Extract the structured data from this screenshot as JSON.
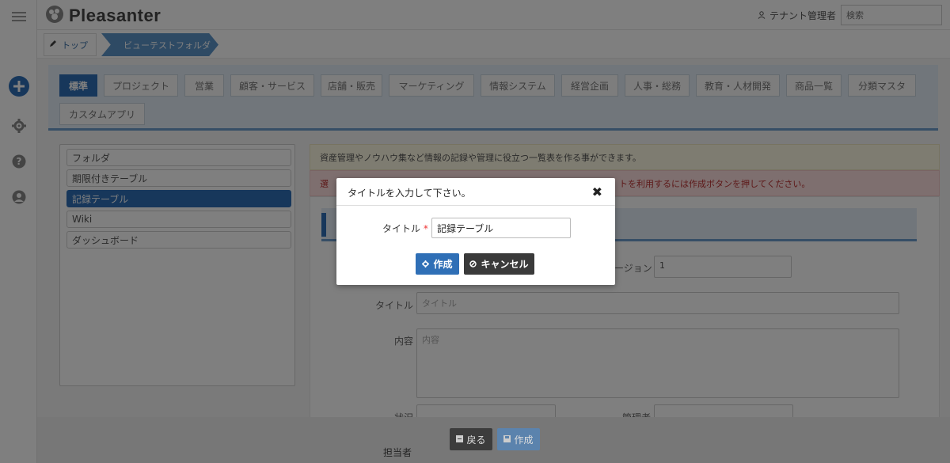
{
  "app": {
    "name": "Pleasanter"
  },
  "header": {
    "user_label": "テナント管理者",
    "search_placeholder": "検索"
  },
  "breadcrumb": {
    "top": "トップ",
    "current": "ビューテストフォルダ"
  },
  "tabs": [
    "標準",
    "プロジェクト",
    "営業",
    "顧客・サービス",
    "店舗・販売",
    "マーケティング",
    "情報システム",
    "経営企画",
    "人事・総務",
    "教育・人材開発",
    "商品一覧",
    "分類マスタ",
    "カスタムアプリ"
  ],
  "template_list": [
    "フォルダ",
    "期限付きテーブル",
    "記録テーブル",
    "Wiki",
    "ダッシュボード"
  ],
  "messages": {
    "info": "資産管理やノウハウ集など情報の記録や管理に役立つ一覧表を作る事ができます。",
    "warn_prefix": "選",
    "warn_tail": "トを利用するには作成ボタンを押してください。"
  },
  "form": {
    "version_label_partial": "ージョン",
    "version_value": "1",
    "title_label": "タイトル",
    "title_placeholder": "タイトル",
    "body_label": "内容",
    "body_placeholder": "内容",
    "status_label": "状況",
    "manager_label": "管理者",
    "owner_label": "担当者"
  },
  "footer": {
    "back": "戻る",
    "create": "作成"
  },
  "modal": {
    "title": "タイトルを入力して下さい。",
    "field_label": "タイトル",
    "required_mark": "*",
    "field_value": "記録テーブル",
    "create_label": "作成",
    "cancel_label": "キャンセル",
    "close_glyph": "✖"
  },
  "colors": {
    "accent": "#2f6fb6",
    "cancel": "#3a3a3a",
    "overlay": "rgba(0,0,0,0.5)"
  }
}
